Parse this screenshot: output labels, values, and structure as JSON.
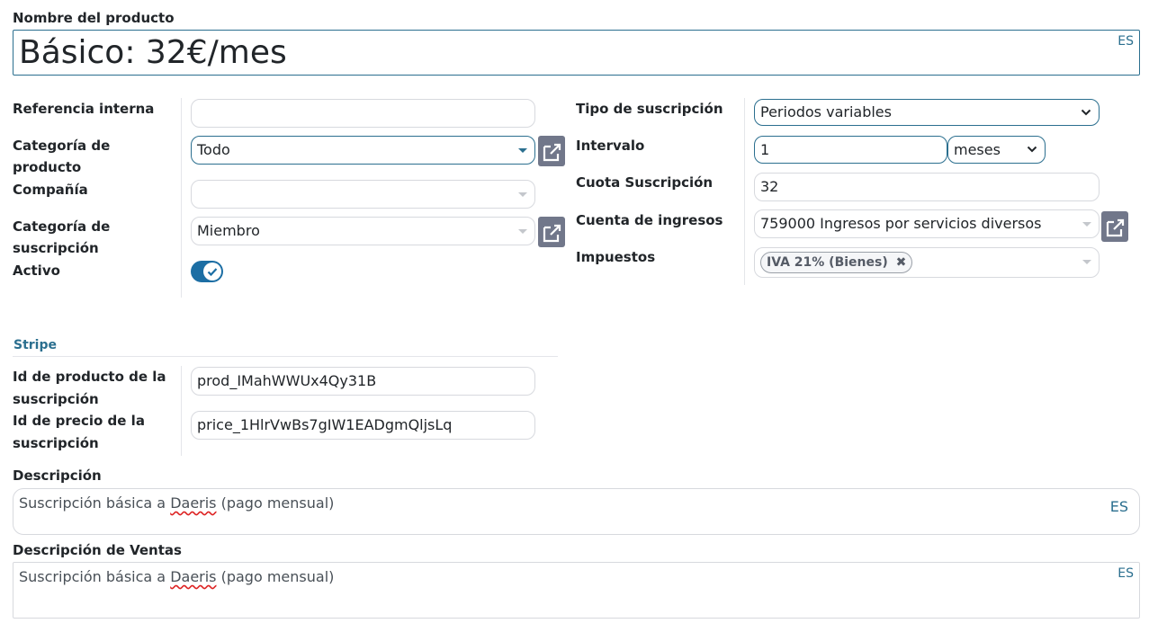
{
  "product_name": {
    "label": "Nombre del producto",
    "value": "Básico: 32€/mes",
    "lang": "ES"
  },
  "left": {
    "internal_ref_label": "Referencia interna",
    "internal_ref_value": "",
    "product_category_label_1": "Categoría de",
    "product_category_label_2": "producto",
    "product_category_value": "Todo",
    "company_label": "Compañía",
    "company_value": "",
    "subscription_category_label_1": "Categoría de",
    "subscription_category_label_2": "suscripción",
    "subscription_category_value": "Miembro",
    "active_label": "Activo",
    "active_state": true
  },
  "right": {
    "subscription_type_label": "Tipo de suscripción",
    "subscription_type_value": "Periodos variables",
    "interval_label": "Intervalo",
    "interval_value": "1",
    "interval_unit": "meses",
    "fee_label": "Cuota Suscripción",
    "fee_value": "32",
    "income_account_label": "Cuenta de ingresos",
    "income_account_value": "759000 Ingresos por servicios diversos",
    "taxes_label": "Impuestos",
    "tax_tags": [
      "IVA 21% (Bienes)"
    ]
  },
  "stripe": {
    "title": "Stripe",
    "product_id_label_1": "Id de producto de la",
    "product_id_label_2": "suscripción",
    "product_id_value": "prod_IMahWWUx4Qy31B",
    "price_id_label_1": "Id de precio de la",
    "price_id_label_2": "suscripción",
    "price_id_value": "price_1HlrVwBs7gIW1EADgmQljsLq"
  },
  "description": {
    "label": "Descripción",
    "text_before": "Suscripción básica a ",
    "text_spell": "Daeris",
    "text_after": " (pago mensual)",
    "lang": "ES"
  },
  "sales_description": {
    "label": "Descripción de Ventas",
    "text_before": "Suscripción básica a ",
    "text_spell": "Daeris",
    "text_after": " (pago mensual)",
    "lang": "ES"
  },
  "icons": {
    "external_link": "external-link-icon",
    "remove_tag": "close-icon",
    "dropdown": "caret-down-icon",
    "select": "chevron-down-icon",
    "toggle_check": "check-icon"
  },
  "colors": {
    "accent": "#2b6f8f",
    "toggle": "#1c6ea4",
    "button": "#71778a",
    "border": "#d7d9de"
  }
}
